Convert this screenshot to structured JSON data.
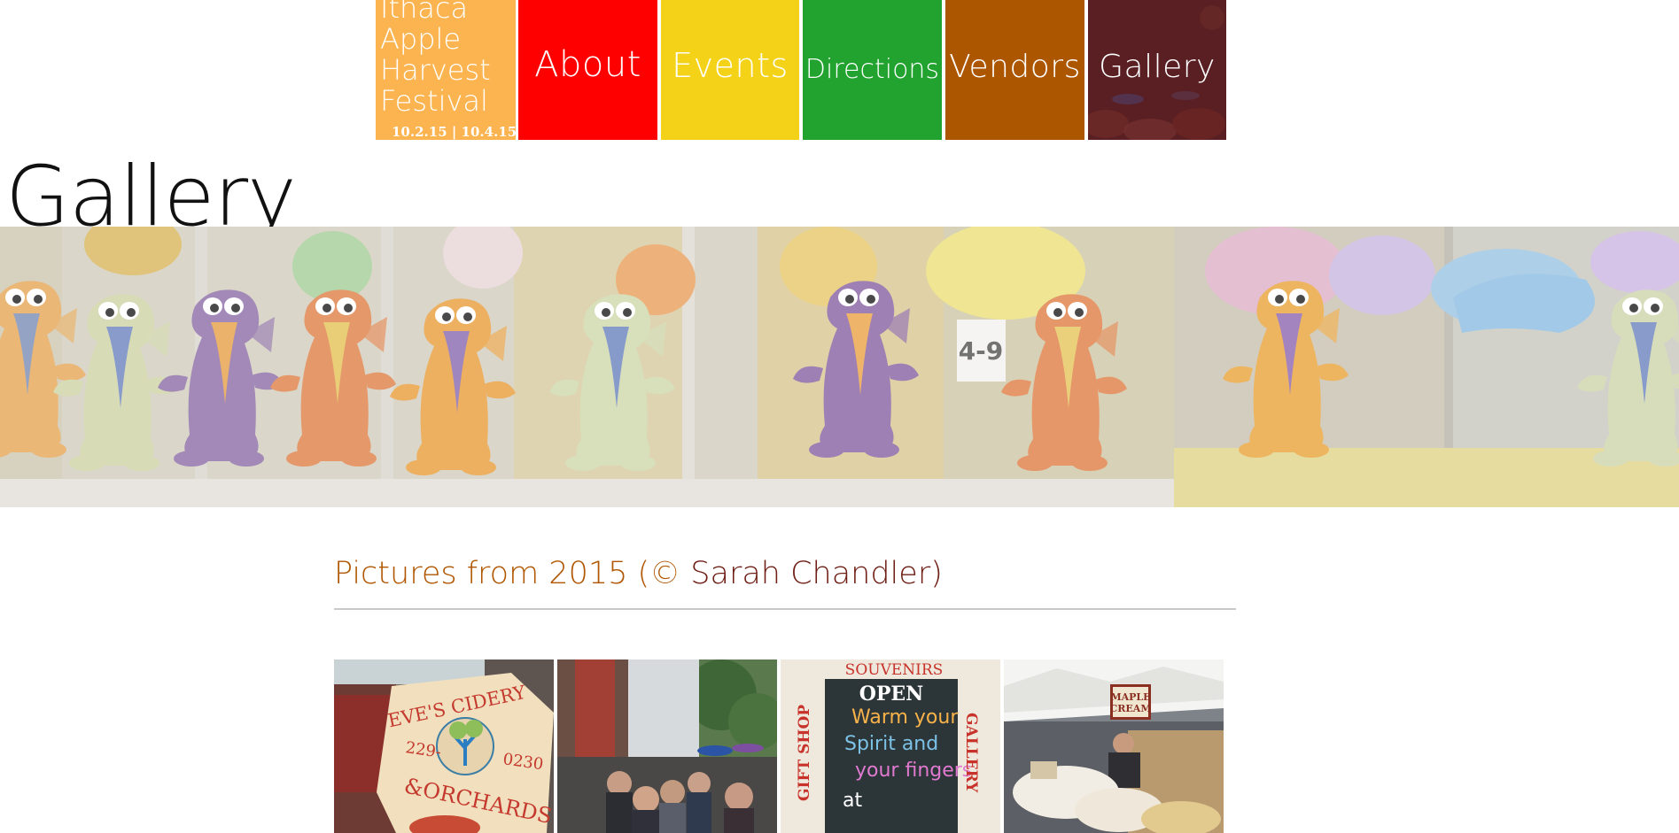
{
  "nav": {
    "brand": {
      "title_lines": [
        "Ithaca",
        "Apple",
        "Harvest",
        "Festival"
      ],
      "dates": "10.2.15 | 10.4.15",
      "color": "#fbb450"
    },
    "items": [
      {
        "label": "About",
        "color": "#ff0000"
      },
      {
        "label": "Events",
        "color": "#f4d218"
      },
      {
        "label": "Directions",
        "color": "#22a32f"
      },
      {
        "label": "Vendors",
        "color": "#ad5600"
      },
      {
        "label": "Gallery",
        "color": "#5a1f22"
      }
    ]
  },
  "page": {
    "title": "Gallery"
  },
  "section": {
    "heading_part1": "Pictures from 2015 (© ",
    "heading_part2": "Sarah Chandler)",
    "heading_colors": [
      "#b05600",
      "#6e1e14"
    ]
  },
  "thumbs": {
    "cider_sign": {
      "line1": "EVE'S CIDERY",
      "line2": "229-",
      "line3": "0230",
      "line4": "&ORCHARDS"
    },
    "chalkboard": {
      "top": "SOUVENIRS",
      "open": "OPEN",
      "line1": "Warm your",
      "line2": "Spirit and",
      "line3": "your fingers",
      "line4": "at",
      "left_side": "GIFT SHOP",
      "right_side": "GALLERY"
    },
    "maple": {
      "line1": "MAPLE",
      "line2": "CREAM"
    }
  }
}
